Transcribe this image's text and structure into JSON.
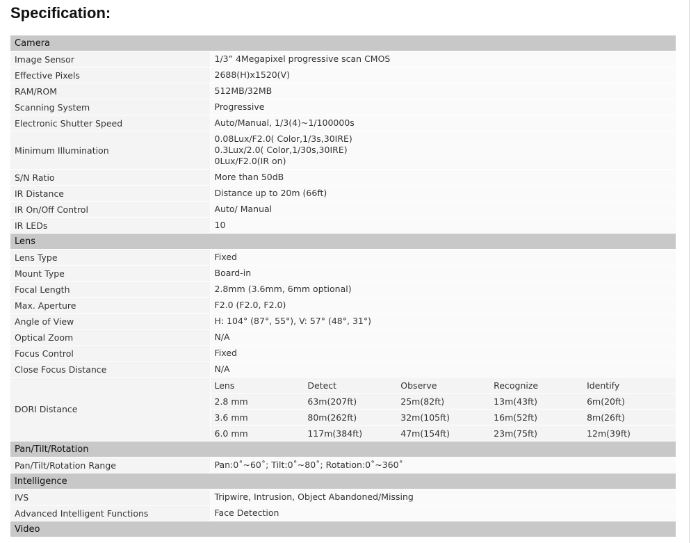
{
  "page": {
    "title": "Specification:"
  },
  "sections": [
    {
      "name": "Camera",
      "rows": [
        {
          "label": "Image Sensor",
          "value": [
            "1/3” 4Megapixel progressive scan CMOS"
          ]
        },
        {
          "label": "Effective Pixels",
          "value": [
            "2688(H)x1520(V)"
          ]
        },
        {
          "label": "RAM/ROM",
          "value": [
            "512MB/32MB"
          ]
        },
        {
          "label": "Scanning System",
          "value": [
            "Progressive"
          ]
        },
        {
          "label": "Electronic Shutter Speed",
          "value": [
            "Auto/Manual, 1/3(4)~1/100000s"
          ]
        },
        {
          "label": "Minimum Illumination",
          "value": [
            "0.08Lux/F2.0( Color,1/3s,30IRE)",
            "0.3Lux/2.0( Color,1/30s,30IRE)",
            "0Lux/F2.0(IR on)"
          ]
        },
        {
          "label": "S/N Ratio",
          "value": [
            "More than 50dB"
          ]
        },
        {
          "label": "IR Distance",
          "value": [
            "Distance up to 20m (66ft)"
          ]
        },
        {
          "label": "IR On/Off Control",
          "value": [
            "Auto/ Manual"
          ]
        },
        {
          "label": "IR LEDs",
          "value": [
            "10"
          ]
        }
      ]
    },
    {
      "name": "Lens",
      "rows": [
        {
          "label": "Lens Type",
          "value": [
            "Fixed"
          ]
        },
        {
          "label": "Mount Type",
          "value": [
            "Board-in"
          ]
        },
        {
          "label": "Focal Length",
          "value": [
            "2.8mm (3.6mm, 6mm optional)"
          ]
        },
        {
          "label": "Max. Aperture",
          "value": [
            "F2.0 (F2.0, F2.0)"
          ]
        },
        {
          "label": "Angle of View",
          "value": [
            "H: 104° (87°, 55°), V: 57° (48°, 31°)"
          ]
        },
        {
          "label": "Optical Zoom",
          "value": [
            "N/A"
          ]
        },
        {
          "label": "Focus Control",
          "value": [
            "Fixed"
          ]
        },
        {
          "label": "Close Focus Distance",
          "value": [
            "N/A"
          ]
        },
        {
          "label": "DORI Distance",
          "table": {
            "headers": [
              "Lens",
              "Detect",
              "Observe",
              "Recognize",
              "Identify"
            ],
            "rows": [
              [
                "2.8 mm",
                "63m(207ft)",
                "25m(82ft)",
                "13m(43ft)",
                "6m(20ft)"
              ],
              [
                "3.6 mm",
                "80m(262ft)",
                "32m(105ft)",
                "16m(52ft)",
                "8m(26ft)"
              ],
              [
                "6.0 mm",
                "117m(384ft)",
                "47m(154ft)",
                "23m(75ft)",
                "12m(39ft)"
              ]
            ]
          }
        }
      ]
    },
    {
      "name": "Pan/Tilt/Rotation",
      "rows": [
        {
          "label": "Pan/Tilt/Rotation Range",
          "value": [
            "Pan:0˚~60˚; Tilt:0˚~80˚; Rotation:0˚~360˚"
          ]
        }
      ]
    },
    {
      "name": "Intelligence",
      "rows": [
        {
          "label": "IVS",
          "value": [
            "Tripwire, Intrusion, Object Abandoned/Missing"
          ]
        },
        {
          "label": "Advanced Intelligent Functions",
          "value": [
            "Face Detection"
          ]
        }
      ]
    },
    {
      "name": "Video",
      "rows": []
    }
  ]
}
